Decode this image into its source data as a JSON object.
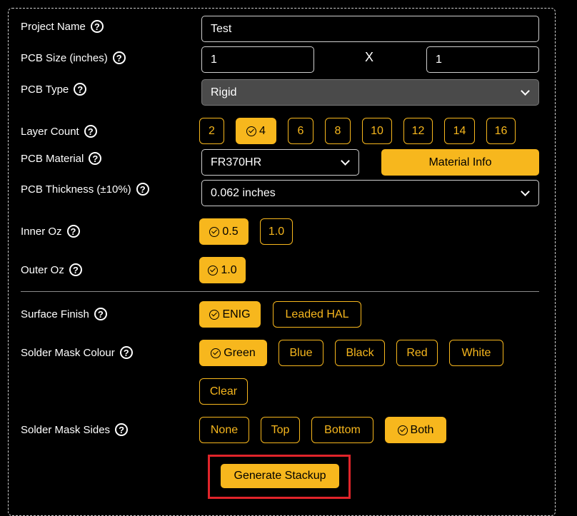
{
  "form": {
    "project_name": {
      "label": "Project Name",
      "value": "Test"
    },
    "pcb_size": {
      "label": "PCB Size (inches)",
      "width": "1",
      "height": "1",
      "separator": "X"
    },
    "pcb_type": {
      "label": "PCB Type",
      "value": "Rigid"
    },
    "layer_count": {
      "label": "Layer Count",
      "options": [
        "2",
        "4",
        "6",
        "8",
        "10",
        "12",
        "14",
        "16"
      ],
      "selected": "4"
    },
    "pcb_material": {
      "label": "PCB Material",
      "value": "FR370HR",
      "info_button": "Material Info"
    },
    "pcb_thickness": {
      "label": "PCB Thickness (±10%)",
      "value": "0.062 inches"
    },
    "inner_oz": {
      "label": "Inner Oz",
      "options": [
        "0.5",
        "1.0"
      ],
      "selected": "0.5"
    },
    "outer_oz": {
      "label": "Outer Oz",
      "options": [
        "1.0"
      ],
      "selected": "1.0"
    },
    "surface_finish": {
      "label": "Surface Finish",
      "options": [
        "ENIG",
        "Leaded HAL"
      ],
      "selected": "ENIG"
    },
    "solder_mask_colour": {
      "label": "Solder Mask Colour",
      "options": [
        "Green",
        "Blue",
        "Black",
        "Red",
        "White",
        "Clear"
      ],
      "selected": "Green"
    },
    "solder_mask_sides": {
      "label": "Solder Mask Sides",
      "options": [
        "None",
        "Top",
        "Bottom",
        "Both"
      ],
      "selected": "Both"
    },
    "generate_button": "Generate Stackup",
    "help_glyph": "?"
  },
  "colors": {
    "accent": "#f7b71d",
    "highlight": "#e0242a",
    "background": "#000000"
  }
}
